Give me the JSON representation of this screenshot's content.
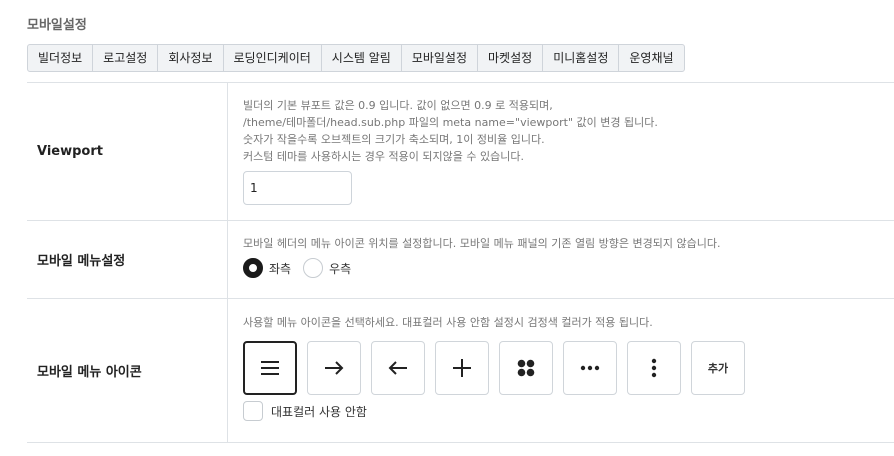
{
  "page": {
    "title": "모바일설정"
  },
  "tabs": [
    {
      "label": "빌더정보"
    },
    {
      "label": "로고설정"
    },
    {
      "label": "회사정보"
    },
    {
      "label": "로딩인디케이터"
    },
    {
      "label": "시스템 알림"
    },
    {
      "label": "모바일설정"
    },
    {
      "label": "마켓설정"
    },
    {
      "label": "미니홈설정"
    },
    {
      "label": "운영채널"
    }
  ],
  "viewport": {
    "label": "Viewport",
    "desc": [
      "빌더의 기본 뷰포트 값은 0.9 입니다. 값이 없으면 0.9 로 적용되며,",
      "/theme/테마폴더/head.sub.php 파일의 meta name=\"viewport\" 값이 변경 됩니다.",
      "숫자가 작을수록 오브젝트의 크기가 축소되며, 1이 정비율 입니다.",
      "커스텀 테마를 사용하시는 경우 적용이 되지않을 수 있습니다."
    ],
    "value": "1"
  },
  "menu_setting": {
    "label": "모바일 메뉴설정",
    "desc": "모바일 헤더의 메뉴 아이콘 위치를 설정합니다. 모바일 메뉴 패널의 기존 열림 방향은 변경되지 않습니다.",
    "options": [
      {
        "label": "좌측",
        "checked": true
      },
      {
        "label": "우측",
        "checked": false
      }
    ]
  },
  "menu_icon": {
    "label": "모바일 메뉴 아이콘",
    "desc": "사용할 메뉴 아이콘을 선택하세요. 대표컬러 사용 안함 설정시 검정색 컬러가 적용 됩니다.",
    "icons": [
      {
        "name": "hamburger-icon",
        "selected": true
      },
      {
        "name": "arrow-right-icon",
        "selected": false
      },
      {
        "name": "arrow-left-icon",
        "selected": false
      },
      {
        "name": "plus-icon",
        "selected": false
      },
      {
        "name": "grid-dots-icon",
        "selected": false
      },
      {
        "name": "more-horizontal-icon",
        "selected": false
      },
      {
        "name": "more-vertical-icon",
        "selected": false
      }
    ],
    "add_label": "추가",
    "checkbox_label": "대표컬러 사용 안함",
    "checkbox_checked": false
  }
}
